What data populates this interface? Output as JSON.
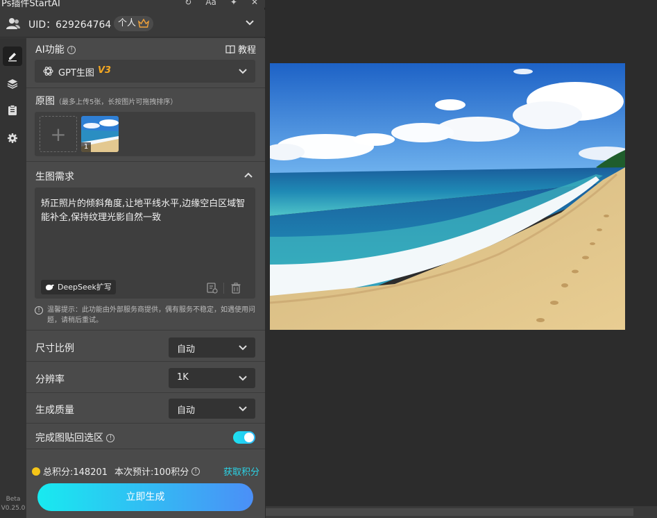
{
  "titlebar": {
    "title": "Ps插件StartAI",
    "icons": [
      "refresh-icon",
      "font-size-icon",
      "pin-icon",
      "close-icon"
    ],
    "font_label": "Aa"
  },
  "account": {
    "uid_text": "UID：629264764",
    "plan": "个人"
  },
  "sidebar": {
    "items": [
      "edit-icon",
      "layers-icon",
      "clipboard-icon",
      "gear-icon"
    ],
    "beta": "Beta",
    "version": "V0.25.0"
  },
  "ai": {
    "title": "AI功能",
    "tutorial": "教程",
    "selected_model": "GPT生图",
    "model_version": "V3"
  },
  "source": {
    "title": "原图",
    "hint": "（最多上传5张，长按图片可拖拽排序）",
    "thumb_index": "1"
  },
  "prompt": {
    "title": "生图需求",
    "text": "矫正照片的倾斜角度,让地平线水平,边缘空白区域智能补全,保持纹理光影自然一致",
    "deepseek_label": "DeepSeek扩写",
    "warning": "温馨提示：此功能由外部服务商提供，偶有服务不稳定，如遇使用问题，请稍后重试。"
  },
  "settings": {
    "ratio": {
      "label": "尺寸比例",
      "value": "自动"
    },
    "resolution": {
      "label": "分辨率",
      "value": "1K"
    },
    "quality": {
      "label": "生成质量",
      "value": "自动"
    },
    "paste_back": {
      "label": "完成图贴回选区",
      "enabled": true
    }
  },
  "footer": {
    "total_points": "总积分:148201",
    "estimate": "本次预计:100积分",
    "get_points": "获取积分",
    "generate": "立即生成"
  },
  "colors": {
    "accent": "#2bd3e6",
    "panel": "#4a4a4a",
    "button_gradient_start": "#18eaf0",
    "button_gradient_end": "#4b8ff7"
  }
}
